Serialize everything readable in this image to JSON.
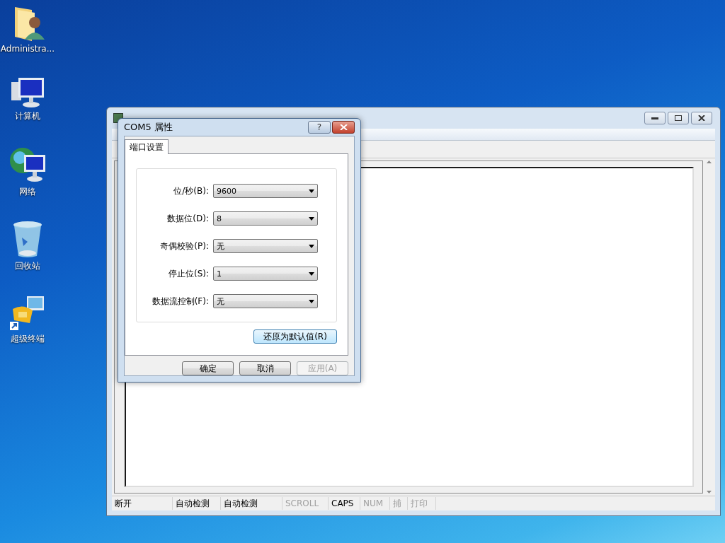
{
  "desktop_icons": [
    {
      "label": "Administra...",
      "kind": "user-folder"
    },
    {
      "label": "计算机",
      "kind": "computer"
    },
    {
      "label": "网络",
      "kind": "network"
    },
    {
      "label": "回收站",
      "kind": "recycle-bin"
    },
    {
      "label": "超级终端",
      "kind": "terminal-shortcut"
    }
  ],
  "main_window": {
    "status_bar": [
      {
        "text": "断开",
        "disabled": false
      },
      {
        "text": "自动检测",
        "disabled": false
      },
      {
        "text": "自动检测",
        "disabled": false
      },
      {
        "text": "SCROLL",
        "disabled": true
      },
      {
        "text": "CAPS",
        "disabled": false
      },
      {
        "text": "NUM",
        "disabled": true
      },
      {
        "text": "捕",
        "disabled": true
      },
      {
        "text": "打印",
        "disabled": true
      }
    ]
  },
  "dialog": {
    "title": "COM5 属性",
    "help_button": "?",
    "tabs": [
      {
        "label": "端口设置",
        "selected": true
      }
    ],
    "fields": [
      {
        "label": "位/秒(B):",
        "value": "9600"
      },
      {
        "label": "数据位(D):",
        "value": "8"
      },
      {
        "label": "奇偶校验(P):",
        "value": "无"
      },
      {
        "label": "停止位(S):",
        "value": "1"
      },
      {
        "label": "数据流控制(F):",
        "value": "无"
      }
    ],
    "restore_button": "还原为默认值(R)",
    "buttons": [
      {
        "label": "确定",
        "disabled": false
      },
      {
        "label": "取消",
        "disabled": false
      },
      {
        "label": "应用(A)",
        "disabled": true
      }
    ]
  }
}
